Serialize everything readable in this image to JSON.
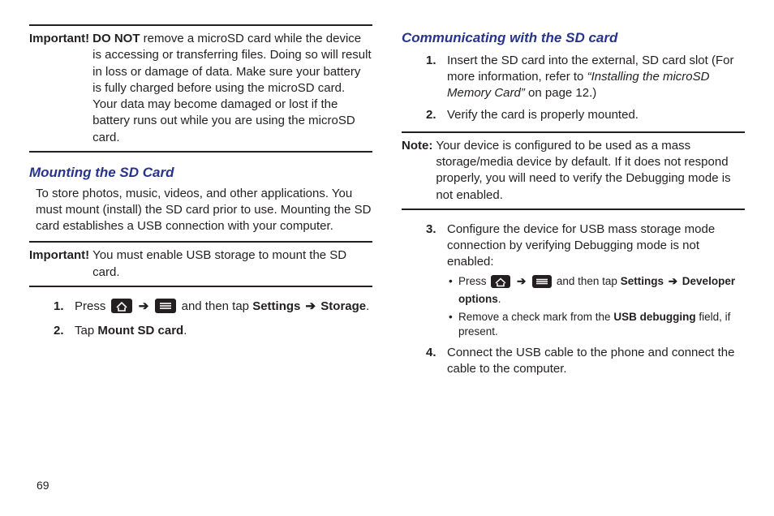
{
  "pageNumber": "69",
  "left": {
    "important1": {
      "label": "Important!",
      "body_intro": "DO NOT",
      "body_rest": " remove a microSD card while the device is accessing or transferring files. Doing so will result in loss or damage of data. Make sure your battery is fully charged before using the microSD card. Your data may become damaged or lost if the battery runs out while you are using the microSD card."
    },
    "heading1": "Mounting the SD Card",
    "para1": "To store photos, music, videos, and other applications. You must mount (install) the SD card prior to use. Mounting the SD card establishes a USB connection with your computer.",
    "important2": {
      "label": "Important!",
      "body": "You must enable USB storage to mount the SD card."
    },
    "steps": {
      "s1a": "Press ",
      "s1b": " and then tap ",
      "s1c": "Settings ",
      "s1d": " Storage",
      "s2a": "Tap ",
      "s2b": "Mount SD card"
    }
  },
  "right": {
    "heading1": "Communicating with the SD card",
    "step1a": "Insert the SD card into the external, SD card slot (For more information, refer to ",
    "step1b": "“Installing the microSD Memory Card”",
    "step1c": "  on page 12.)",
    "step2": "Verify the card is properly mounted.",
    "note": {
      "label": "Note:",
      "body": "Your device is configured to be used as a mass storage/media device by default. If it does not respond properly, you will need to verify the Debugging mode is not enabled."
    },
    "step3": "Configure the device for USB mass storage mode connection by verifying Debugging mode is not enabled:",
    "b1a": "Press ",
    "b1b": " and then tap ",
    "b1c": "Settings ",
    "b1d": " Developer options",
    "b2a": "Remove a check mark from the ",
    "b2b": "USB debugging",
    "b2c": " field, if present.",
    "step4": "Connect the USB cable to the phone and connect the cable to the computer."
  }
}
